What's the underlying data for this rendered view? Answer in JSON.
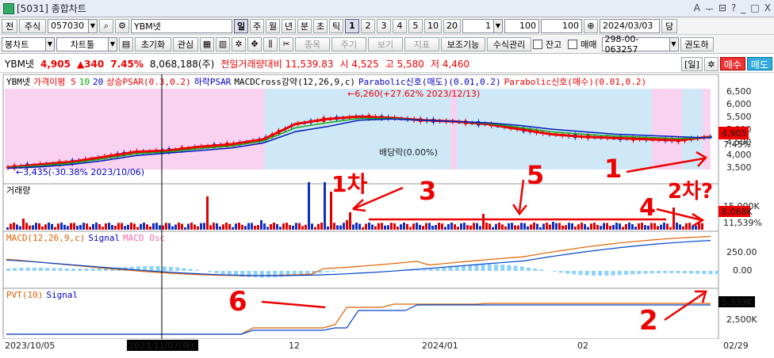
{
  "window": {
    "title": "[5031] 종합차트",
    "controls": [
      "A",
      "ᅮ",
      "⊟",
      "?",
      "_",
      "□",
      "X"
    ]
  },
  "toolbar1": {
    "tab_all": "전",
    "stock_label": "주식",
    "code": "057030",
    "stock_name": "YBM넷",
    "periods": [
      "일",
      "주",
      "월",
      "년",
      "분",
      "초",
      "틱"
    ],
    "period_selected": "일",
    "numbers": [
      "1",
      "2",
      "3",
      "4",
      "5",
      "10",
      "20"
    ],
    "number_selected": "1",
    "unit_value": "1",
    "count_value": "100",
    "count_value2": "100",
    "date": "2024/03/03",
    "pin_label": "당"
  },
  "toolbar2": {
    "chart_type": "봉차트",
    "chart_tools": "차트툴",
    "init": "초기화",
    "interest": "관심",
    "order": "종목",
    "cycle": "주기",
    "view": "보기",
    "indicator": "지표",
    "aux": "보조기능",
    "formula": "수식관리",
    "balance_label": "잔고",
    "trade_label": "매매",
    "account": "298-00-063257",
    "permission": "권도하"
  },
  "info": {
    "name": "YBM넷",
    "price": "4,905",
    "change": "▲340",
    "pct": "7.45%",
    "volume": "8,068,188(주)",
    "prev_vol_label": "전일거래량대비 11,539.83",
    "open": "시 4,525",
    "high": "고 5,580",
    "low": "저 4,460",
    "daily_btn": "[일]",
    "sell_btn": "매수",
    "buy_btn": "매도"
  },
  "price_panel": {
    "legend": [
      "YBM넷",
      "가격이평 5",
      "10",
      "20",
      "상승PSAR(0.3,0.2)",
      "하락PSAR",
      "MACDCross강약(12,26,9,c)",
      "Parabolic신호(매도)(0.01,0.2)",
      "Parabolic신호(매수)(0.01,0.2)"
    ],
    "high_annotation": "6,260(+27.62% 2023/12/13)",
    "low_annotation": "3,435(-30.38% 2023/10/06)",
    "dividend_label": "배당락(0.00%)",
    "y_ticks": [
      "6,500",
      "6,000",
      "5,500",
      "5,000",
      "4,500",
      "4,000",
      "3,500"
    ],
    "price_tag": "4,905",
    "pct_tag": "7.45%"
  },
  "volume_panel": {
    "legend": "거래량",
    "tag": "8,068K",
    "tag2": "11,539%",
    "tag3": "15,000K"
  },
  "macd_panel": {
    "legend": [
      "MACD(12,26,9,c)",
      "Signal",
      "MACD Osc"
    ],
    "y_ticks": [
      "250.00",
      "0.00"
    ]
  },
  "pvt_panel": {
    "legend": [
      "PVT(10)",
      "Signal"
    ],
    "tag": "5,339K",
    "y_ticks": [
      "2,500K"
    ]
  },
  "x_axis": {
    "labels": [
      "2023/10/05",
      "2023/11/07(화)",
      "12",
      "2024/01",
      "02",
      "02/29"
    ]
  },
  "annotations": {
    "a1": "1차",
    "a2": "2차?",
    "n3": "3",
    "n5": "5",
    "n1": "1",
    "n4": "4",
    "n6": "6",
    "n2": "2"
  },
  "chart_data": {
    "type": "line",
    "series": [
      {
        "name": "가격이평 5",
        "values": [
          3480,
          3600,
          3700,
          3900,
          4100,
          4150,
          4300,
          4400,
          4600,
          5200,
          5400,
          5500,
          5450,
          5350,
          5300,
          5200,
          5000,
          4800,
          4700,
          4650,
          4600,
          4550,
          4700
        ]
      },
      {
        "name": "20",
        "values": [
          3450,
          3500,
          3600,
          3750,
          3950,
          4050,
          4150,
          4250,
          4450,
          4900,
          5100,
          5350,
          5400,
          5350,
          5300,
          5250,
          5150,
          5000,
          4900,
          4800,
          4750,
          4700,
          4650
        ]
      }
    ],
    "ylim": [
      3400,
      6600
    ]
  },
  "colors": {
    "up": "#e00000",
    "down": "#1030c0",
    "pink_bg": "#f9d2f2",
    "blue_bg": "#cfe8f8",
    "annotation": "#e00000"
  }
}
